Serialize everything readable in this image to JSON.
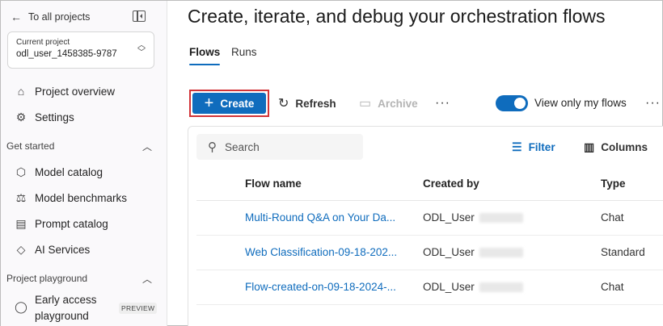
{
  "sidebar": {
    "back_label": "To all projects",
    "project_label": "Current project",
    "project_name": "odl_user_1458385-9787",
    "nav_top": [
      {
        "label": "Project overview"
      },
      {
        "label": "Settings"
      }
    ],
    "section_get_started": "Get started",
    "nav_get_started": [
      {
        "label": "Model catalog"
      },
      {
        "label": "Model benchmarks"
      },
      {
        "label": "Prompt catalog"
      },
      {
        "label": "AI Services"
      }
    ],
    "section_playground": "Project playground",
    "playground_item_line1": "Early access",
    "playground_item_line2": "playground",
    "preview_badge": "PREVIEW"
  },
  "main": {
    "title": "Create, iterate, and debug your orchestration flows",
    "tabs": [
      {
        "label": "Flows",
        "active": true
      },
      {
        "label": "Runs",
        "active": false
      }
    ],
    "toolbar": {
      "create_label": "Create",
      "refresh_label": "Refresh",
      "archive_label": "Archive",
      "toggle_label": "View only my flows",
      "toggle_on": true
    },
    "table": {
      "search_placeholder": "Search",
      "filter_label": "Filter",
      "columns_label": "Columns",
      "headers": {
        "name": "Flow name",
        "created_by": "Created by",
        "type": "Type"
      },
      "rows": [
        {
          "name": "Multi-Round Q&A on Your Da...",
          "created_by": "ODL_User",
          "type": "Chat"
        },
        {
          "name": "Web Classification-09-18-202...",
          "created_by": "ODL_User",
          "type": "Standard"
        },
        {
          "name": "Flow-created-on-09-18-2024-...",
          "created_by": "ODL_User",
          "type": "Chat"
        }
      ]
    }
  },
  "colors": {
    "accent": "#0f6cbd",
    "highlight_outline": "#d13438"
  }
}
